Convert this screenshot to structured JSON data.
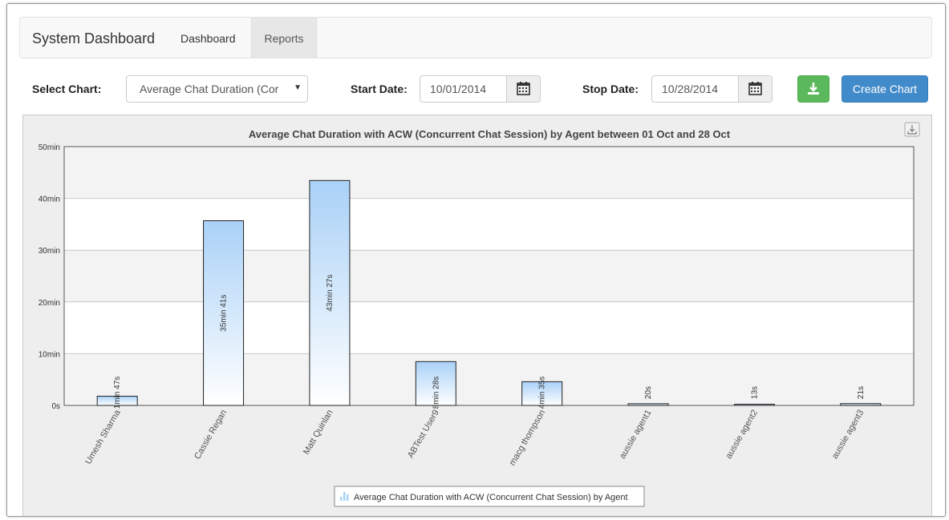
{
  "navbar": {
    "brand": "System Dashboard",
    "tabs": [
      {
        "label": "Dashboard",
        "active": false
      },
      {
        "label": "Reports",
        "active": true
      }
    ]
  },
  "toolbar": {
    "select_chart_label": "Select Chart:",
    "select_chart_value": "Average Chat Duration (Cor",
    "start_date_label": "Start Date:",
    "start_date_value": "10/01/2014",
    "stop_date_label": "Stop Date:",
    "stop_date_value": "10/28/2014",
    "download_icon": "download-icon",
    "create_chart_label": "Create Chart"
  },
  "colors": {
    "download_button": "#5cb85c",
    "create_button": "#428bca",
    "bar_top": "#a9d1f7",
    "bar_bottom": "#ffffff",
    "bar_stroke": "#222222"
  },
  "chart_data": {
    "type": "bar",
    "title": "Average Chat Duration with ACW (Concurrent Chat Session) by Agent between 01 Oct and 28 Oct",
    "categories": [
      "Umesh Sharma",
      "Cassie Regan",
      "Matt Quinlan",
      "ABTest User9",
      "macg thompson",
      "aussie agent1",
      "aussie agent2",
      "aussie agent3"
    ],
    "series": [
      {
        "name": "Average Chat Duration with ACW (Concurrent Chat Session) by Agent",
        "values": [
          107,
          2141,
          2607,
          508,
          275,
          20,
          13,
          21
        ],
        "labels": [
          "1min 47s",
          "35min 41s",
          "43min 27s",
          "8min 28s",
          "4min 35s",
          "20s",
          "13s",
          "21s"
        ]
      }
    ],
    "y_ticks": [
      0,
      600,
      1200,
      1800,
      2400,
      3000
    ],
    "y_tick_labels": [
      "0s",
      "10min",
      "20min",
      "30min",
      "40min",
      "50min"
    ],
    "ylim": [
      0,
      3000
    ],
    "grid": true,
    "legend_position": "bottom-center",
    "export_icon": "export-icon"
  }
}
